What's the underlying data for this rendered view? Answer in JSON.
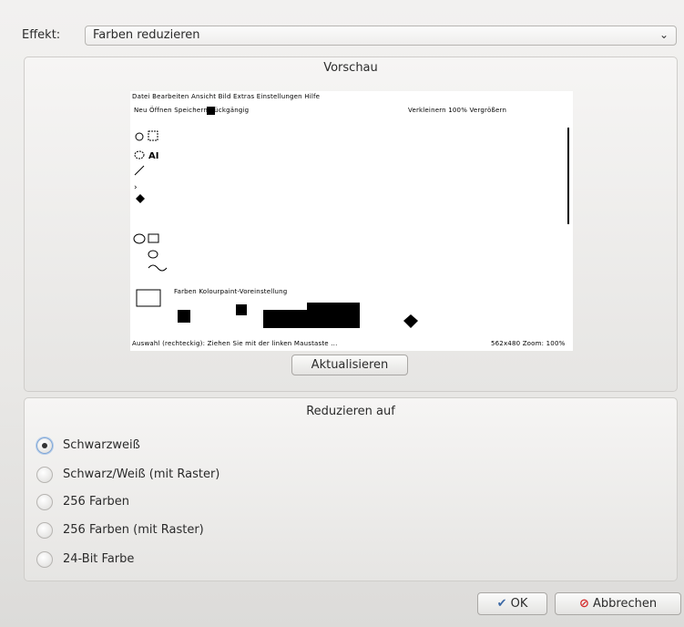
{
  "effect": {
    "label": "Effekt:",
    "value": "Farben reduzieren"
  },
  "preview": {
    "title": "Vorschau",
    "menubar": "Datei  Bearbeiten  Ansicht  Bild  Extras  Einstellungen  Hilfe",
    "toolbar_left": "Neu    Öffnen   Speichern        Rückgängig",
    "toolbar_right": "Verkleinern   100%   Vergrößern",
    "palette": "Farben  Kolourpaint-Voreinstellung",
    "status_left": "Auswahl (rechteckig): Ziehen Sie mit der linken Maustaste ...",
    "status_right": "562x480   Zoom: 100%"
  },
  "refresh_button": "Aktualisieren",
  "reduce": {
    "title": "Reduzieren auf",
    "options": [
      {
        "label": "Schwarzweiß",
        "checked": true
      },
      {
        "label": "Schwarz/Weiß (mit Raster)",
        "checked": false
      },
      {
        "label": "256 Farben",
        "checked": false
      },
      {
        "label": "256 Farben (mit Raster)",
        "checked": false
      },
      {
        "label": "24-Bit Farbe",
        "checked": false
      }
    ]
  },
  "buttons": {
    "ok": "OK",
    "cancel": "Abbrechen"
  }
}
